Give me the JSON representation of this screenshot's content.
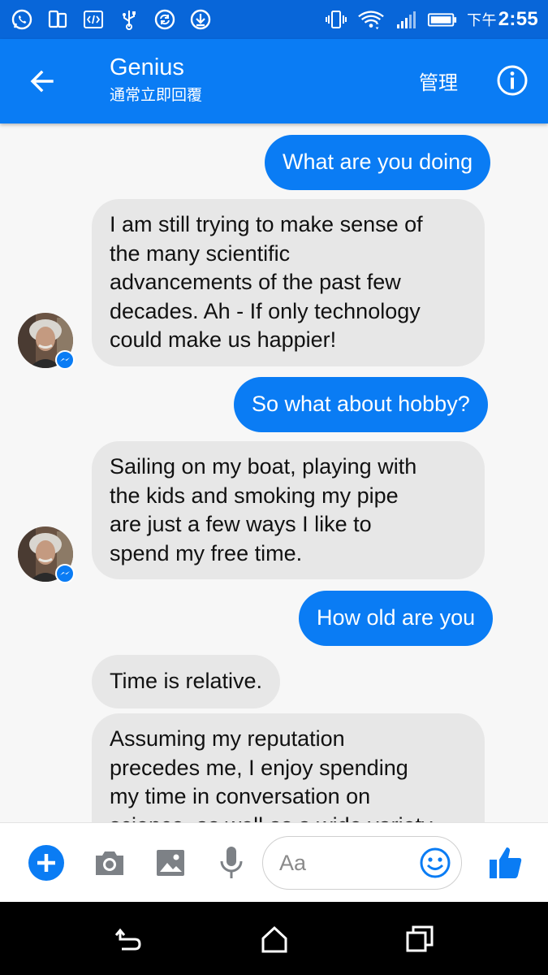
{
  "status_bar": {
    "ampm": "下午",
    "time": "2:55",
    "left_icons": [
      "whatsapp-icon",
      "phone-sync-icon",
      "code-icon",
      "usb-icon",
      "sync-icon",
      "download-icon"
    ],
    "right_icons": [
      "vibrate-icon",
      "wifi-icon",
      "signal-icon",
      "battery-icon"
    ]
  },
  "header": {
    "title": "Genius",
    "subtitle": "通常立即回覆",
    "manage_label": "管理",
    "back_icon": "arrow-left-icon",
    "info_icon": "info-icon"
  },
  "messages": [
    {
      "side": "out",
      "text": "What are you doing"
    },
    {
      "side": "in",
      "lines": [
        "I am still trying to make sense of",
        "the many scientific",
        "advancements of the past few",
        "decades. Ah - If only technology",
        "could make us happier!"
      ]
    },
    {
      "side": "out",
      "text": "So what about hobby?"
    },
    {
      "side": "in",
      "lines": [
        "Sailing on my boat, playing with",
        "the kids and smoking my pipe",
        "are just a few ways I like to",
        "spend my free time."
      ]
    },
    {
      "side": "out",
      "text": "How old are you"
    },
    {
      "side": "in",
      "lines": [
        "Time is relative."
      ]
    },
    {
      "side": "in",
      "lines": [
        "Assuming my reputation",
        "precedes me, I enjoy spending",
        "my time in conversation on",
        "science, as well as a wide variety"
      ]
    }
  ],
  "composer": {
    "placeholder": "Aa",
    "icons": [
      "plus-icon",
      "camera-icon",
      "gallery-icon",
      "microphone-icon",
      "emoji-icon",
      "thumbs-up-icon"
    ]
  },
  "nav_bar": {
    "icons": [
      "back-nav-icon",
      "home-nav-icon",
      "recents-nav-icon"
    ]
  },
  "colors": {
    "status_bar": "#0866d9",
    "header": "#0a7cf4",
    "outgoing_bubble": "#0a7cf4",
    "incoming_bubble": "#e7e7e7",
    "background": "#f7f7f7"
  }
}
